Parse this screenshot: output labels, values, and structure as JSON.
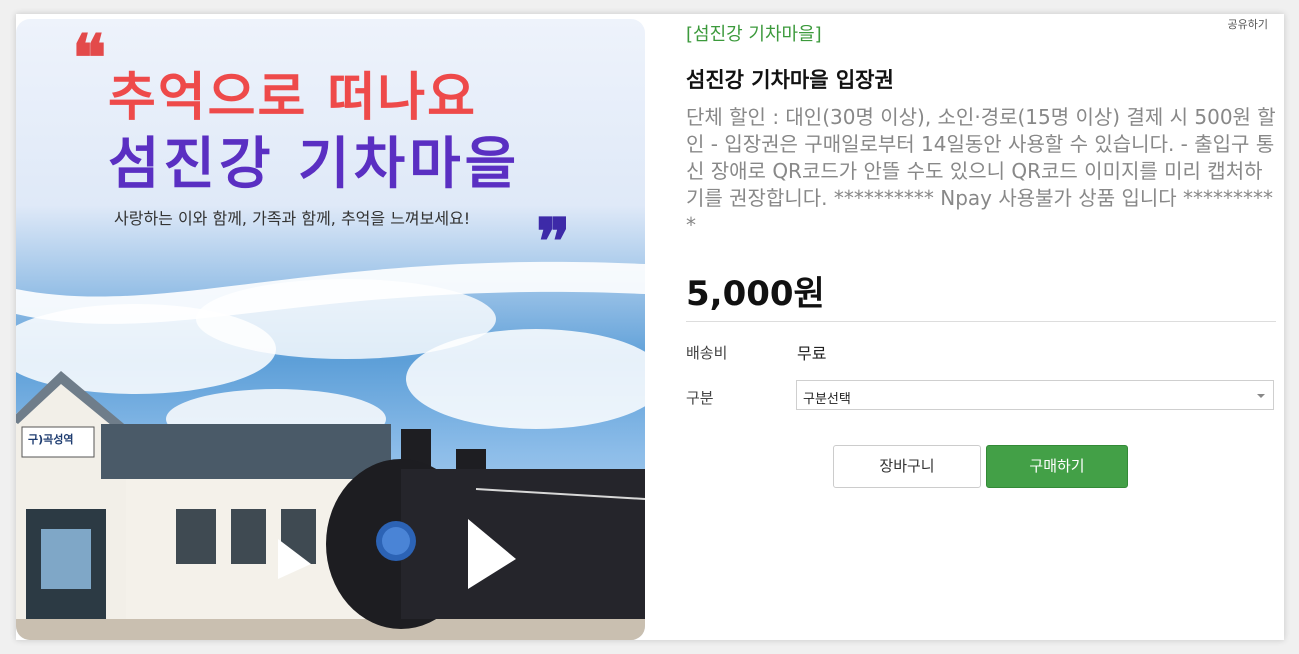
{
  "hero": {
    "title_line1": "추억으로 떠나요",
    "title_line2": "섬진강 기차마을",
    "subtitle": "사랑하는 이와 함께, 가족과 함께, 추억을 느껴보세요!",
    "quote_open": "❝",
    "quote_close": "❞",
    "station_sign": "구)곡성역"
  },
  "product": {
    "category": "[섬진강 기차마을]",
    "share_label": "공유하기",
    "title": "섬진강 기차마을 입장권",
    "description": "단체 할인 : 대인(30명 이상), 소인·경로(15명 이상) 결제 시 500원 할인 - 입장권은 구매일로부터 14일동안 사용할 수 있습니다. - 출입구 통신 장애로 QR코드가 안뜰 수도 있으니 QR코드 이미지를 미리 캡처하기를 권장합니다. ********** Npay 사용불가 상품 입니다 **********",
    "price": "5,000원"
  },
  "options": {
    "shipping_label": "배송비",
    "shipping_value": "무료",
    "type_label": "구분",
    "type_selected": "구분선택"
  },
  "buttons": {
    "cart_label": "장바구니",
    "buy_label": "구매하기"
  },
  "colors": {
    "accent_green": "#43a047",
    "category_green": "#3c9a3c",
    "title_red": "#ee4a4a",
    "title_purple": "#5a2fc2"
  }
}
